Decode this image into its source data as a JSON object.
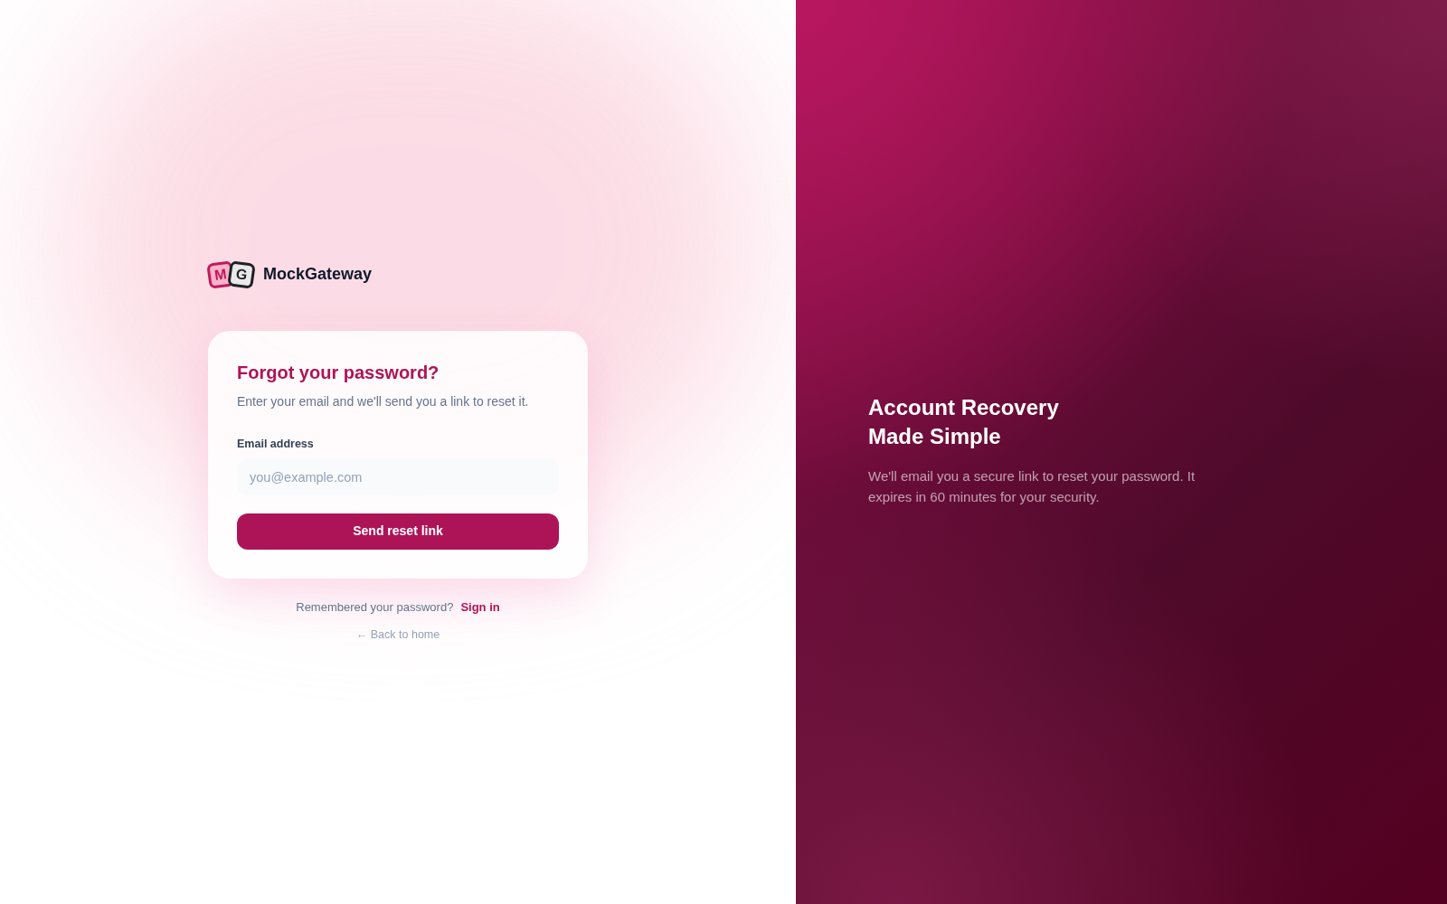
{
  "brand": {
    "logo_letters": [
      "M",
      "G"
    ],
    "name": "MockGateway"
  },
  "card": {
    "title": "Forgot your password?",
    "subtitle": "Enter your email and we'll send you a link to reset it.",
    "email_field": {
      "label": "Email address",
      "placeholder": "you@example.com"
    },
    "submit_button": "Send reset link"
  },
  "footer": {
    "prompt": "Remembered your password?",
    "sign_in_link": "Sign in",
    "back_link": "← Back to home"
  },
  "hero": {
    "title_lines": [
      "Account Recovery",
      "Made Simple"
    ],
    "description": "We'll email you a secure link to reset your password. It expires in 60 minutes for your security."
  }
}
